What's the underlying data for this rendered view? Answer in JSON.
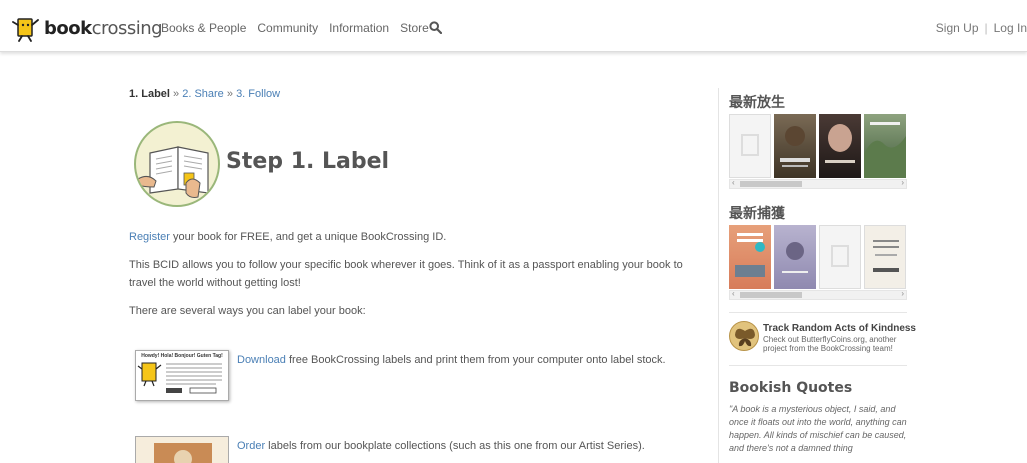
{
  "header": {
    "logo_part1": "book",
    "logo_part2": "crossing",
    "nav": [
      "Books & People",
      "Community",
      "Information",
      "Store"
    ],
    "auth": {
      "signup": "Sign Up",
      "separator": "|",
      "login": "Log In"
    }
  },
  "breadcrumb": {
    "step1": "1. Label",
    "sep": "»",
    "step2": "2. Share",
    "step3": "3. Follow"
  },
  "main": {
    "title": "Step 1. Label",
    "p1_link": "Register",
    "p1_text": " your book for FREE, and get a unique BookCrossing ID.",
    "p2": "This BCID allows you to follow your specific book wherever it goes. Think of it as a passport enabling your book to travel the world without getting lost!",
    "p3": "There are several ways you can label your book:",
    "opt1_link": "Download",
    "opt1_text": " free BookCrossing labels and print them from your computer onto label stock.",
    "opt2_link": "Order",
    "opt2_text": " labels from our bookplate collections (such as this one from our Artist Series).",
    "label_thumb_title": "Howdy! Hola! Bonjour! Guten Tag!"
  },
  "sidebar": {
    "latest_released": "最新放生",
    "latest_caught": "最新捕獲",
    "promo_title": "Track Random Acts of Kindness",
    "promo_text": "Check out ButterflyCoins.org, another project from the BookCrossing team!",
    "quotes_title": "Bookish Quotes",
    "quote": "\"A book is a mysterious object, I said, and once it floats out into the world, anything can happen. All kinds of mischief can be caused, and there's not a damned thing"
  },
  "colors": {
    "link": "#4a7fb5",
    "logo_yellow": "#f5c518"
  }
}
